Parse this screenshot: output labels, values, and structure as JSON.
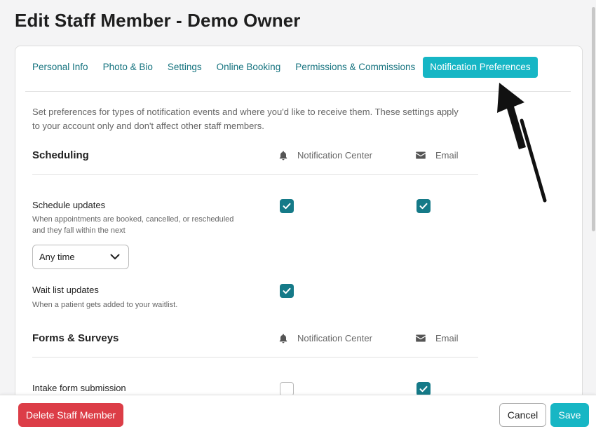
{
  "page": {
    "title": "Edit Staff Member - Demo Owner"
  },
  "tabs": [
    {
      "label": "Personal Info",
      "active": false
    },
    {
      "label": "Photo & Bio",
      "active": false
    },
    {
      "label": "Settings",
      "active": false
    },
    {
      "label": "Online Booking",
      "active": false
    },
    {
      "label": "Permissions & Commissions",
      "active": false
    },
    {
      "label": "Notification Preferences",
      "active": true
    }
  ],
  "intro": "Set preferences for types of notification events and where you'd like to receive them. These settings apply to your account only and don't affect other staff members.",
  "columns": {
    "notification_center": "Notification Center",
    "email": "Email"
  },
  "sections": {
    "scheduling": {
      "title": "Scheduling",
      "schedule_updates": {
        "title": "Schedule updates",
        "description": "When appointments are booked, cancelled, or rescheduled and they fall within the next",
        "notification_center": true,
        "email": true,
        "timeframe": "Any time"
      },
      "wait_list_updates": {
        "title": "Wait list updates",
        "description": "When a patient gets added to your waitlist.",
        "notification_center": true
      }
    },
    "forms": {
      "title": "Forms & Surveys",
      "intake_form": {
        "title": "Intake form submission",
        "notification_center": false,
        "email": true
      }
    }
  },
  "footer": {
    "delete_label": "Delete Staff Member",
    "cancel_label": "Cancel",
    "save_label": "Save"
  },
  "colors": {
    "accent": "#16b6c5",
    "checkbox": "#157a88",
    "danger": "#dc3d47",
    "tab_text": "#15737f"
  },
  "icons": {
    "bell": "bell-icon",
    "mail": "mail-icon",
    "check": "check-icon",
    "chevron": "chevron-down-icon",
    "arrow": "annotation-arrow"
  }
}
